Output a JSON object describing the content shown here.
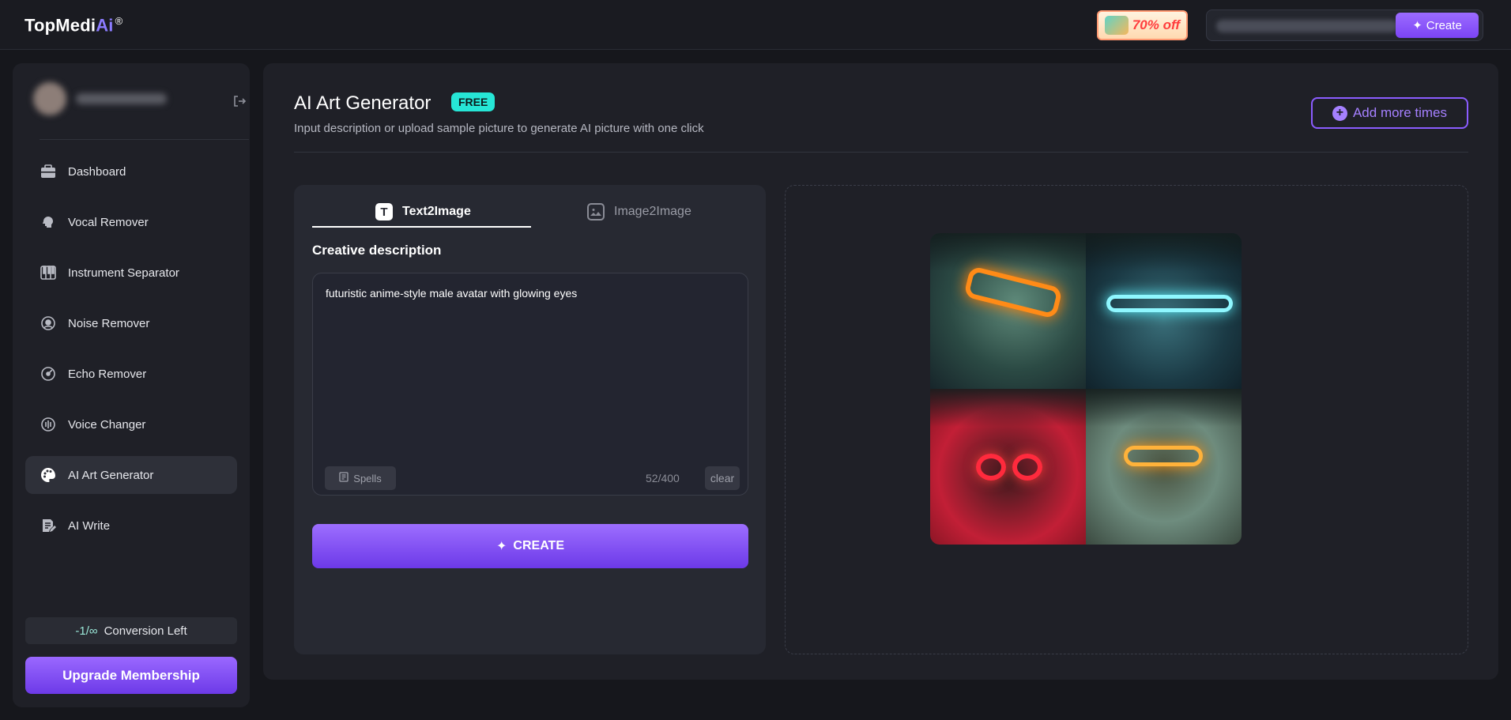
{
  "header": {
    "logo_text_1": "TopMedi",
    "logo_text_2": "Ai",
    "logo_reg": "®",
    "promo_label": "70% off",
    "create_label": "Create"
  },
  "sidebar": {
    "items": [
      {
        "label": "Dashboard",
        "icon": "briefcase-icon"
      },
      {
        "label": "Vocal Remover",
        "icon": "head-voice-icon"
      },
      {
        "label": "Instrument Separator",
        "icon": "piano-icon"
      },
      {
        "label": "Noise Remover",
        "icon": "noise-icon"
      },
      {
        "label": "Echo Remover",
        "icon": "echo-icon"
      },
      {
        "label": "Voice Changer",
        "icon": "voice-changer-icon"
      },
      {
        "label": "AI Art Generator",
        "icon": "palette-icon",
        "active": true
      },
      {
        "label": "AI Write",
        "icon": "write-icon"
      }
    ],
    "conversion_count": "-1/∞",
    "conversion_label": "Conversion Left",
    "upgrade_label": "Upgrade Membership"
  },
  "main": {
    "title": "AI Art Generator",
    "badge": "FREE",
    "subtitle": "Input description or upload sample picture to generate AI picture with one click",
    "add_more_label": "Add more times",
    "tabs": [
      {
        "label": "Text2Image",
        "active": true
      },
      {
        "label": "Image2Image",
        "active": false
      }
    ],
    "section_label": "Creative description",
    "prompt_value": "futuristic anime-style male avatar with glowing eyes",
    "spells_label": "Spells",
    "char_count": "52/400",
    "clear_label": "clear",
    "create_label": "CREATE"
  },
  "colors": {
    "accent": "#8b5cff",
    "badge": "#26e6d6",
    "background": "#16171c",
    "panel": "#1f2027"
  }
}
